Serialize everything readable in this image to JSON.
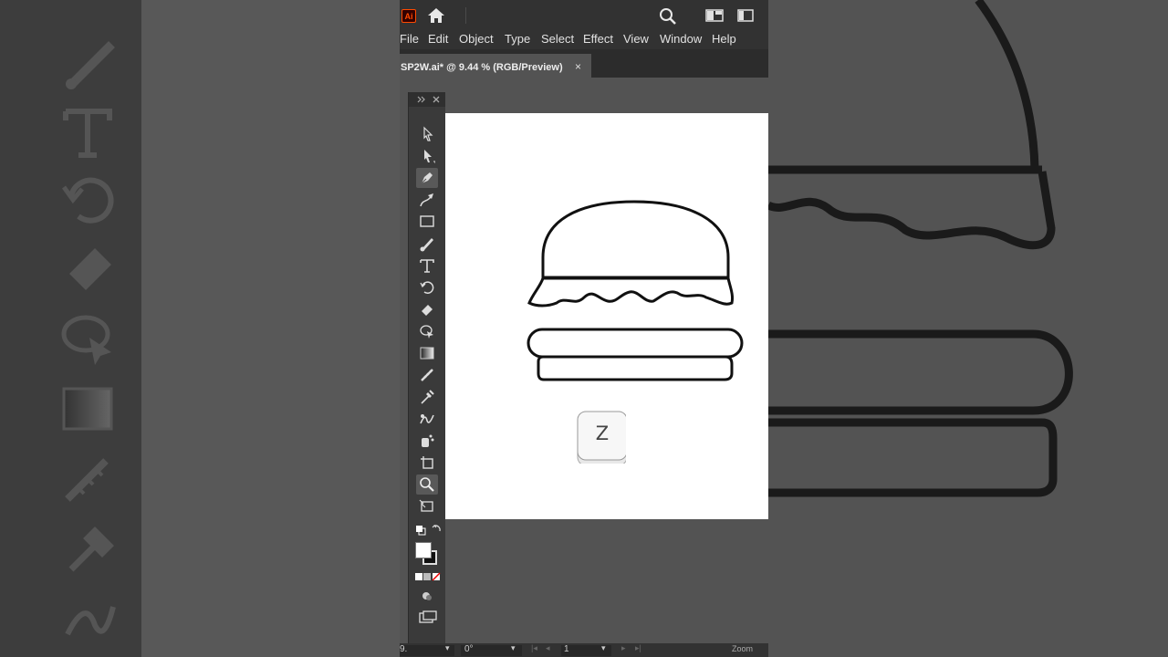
{
  "app": {
    "logo_text": "Ai",
    "document_tab": "SP2W.ai* @ 9.44 % (RGB/Preview)",
    "close_symbol": "×",
    "menus": [
      "File",
      "Edit",
      "Object",
      "Type",
      "Select",
      "Effect",
      "View",
      "Window",
      "Help"
    ]
  },
  "tools": [
    {
      "name": "selection-tool",
      "icon": "arrow-outline-icon"
    },
    {
      "name": "direct-selection-tool",
      "icon": "arrow-filled-icon"
    },
    {
      "name": "pen-tool",
      "icon": "pen-icon",
      "active": true
    },
    {
      "name": "curvature-tool",
      "icon": "curvature-icon"
    },
    {
      "name": "rectangle-tool",
      "icon": "rectangle-icon"
    },
    {
      "name": "paintbrush-tool",
      "icon": "brush-icon"
    },
    {
      "name": "type-tool",
      "icon": "type-icon"
    },
    {
      "name": "rotate-tool",
      "icon": "rotate-icon"
    },
    {
      "name": "eraser-tool",
      "icon": "eraser-icon"
    },
    {
      "name": "shape-builder-tool",
      "icon": "shape-builder-icon"
    },
    {
      "name": "gradient-tool",
      "icon": "gradient-icon"
    },
    {
      "name": "measure-tool",
      "icon": "measure-icon"
    },
    {
      "name": "eyedropper-tool",
      "icon": "eyedropper-icon"
    },
    {
      "name": "blend-tool",
      "icon": "blend-icon"
    },
    {
      "name": "symbol-sprayer-tool",
      "icon": "symbol-sprayer-icon"
    },
    {
      "name": "artboard-tool",
      "icon": "artboard-icon"
    },
    {
      "name": "zoom-tool",
      "icon": "zoom-icon",
      "active": true
    },
    {
      "name": "print-tiling-tool",
      "icon": "print-tiling-icon"
    }
  ],
  "overlay": {
    "key_label": "Z"
  },
  "status": {
    "zoom_value": "9.",
    "rotation_value": "0°",
    "artboard_number": "1",
    "tool_name": "Zoom"
  },
  "colors": {
    "app_background": "#535353",
    "panel": "#323232",
    "artboard": "#ffffff",
    "brand_accent": "#ff4a00"
  }
}
